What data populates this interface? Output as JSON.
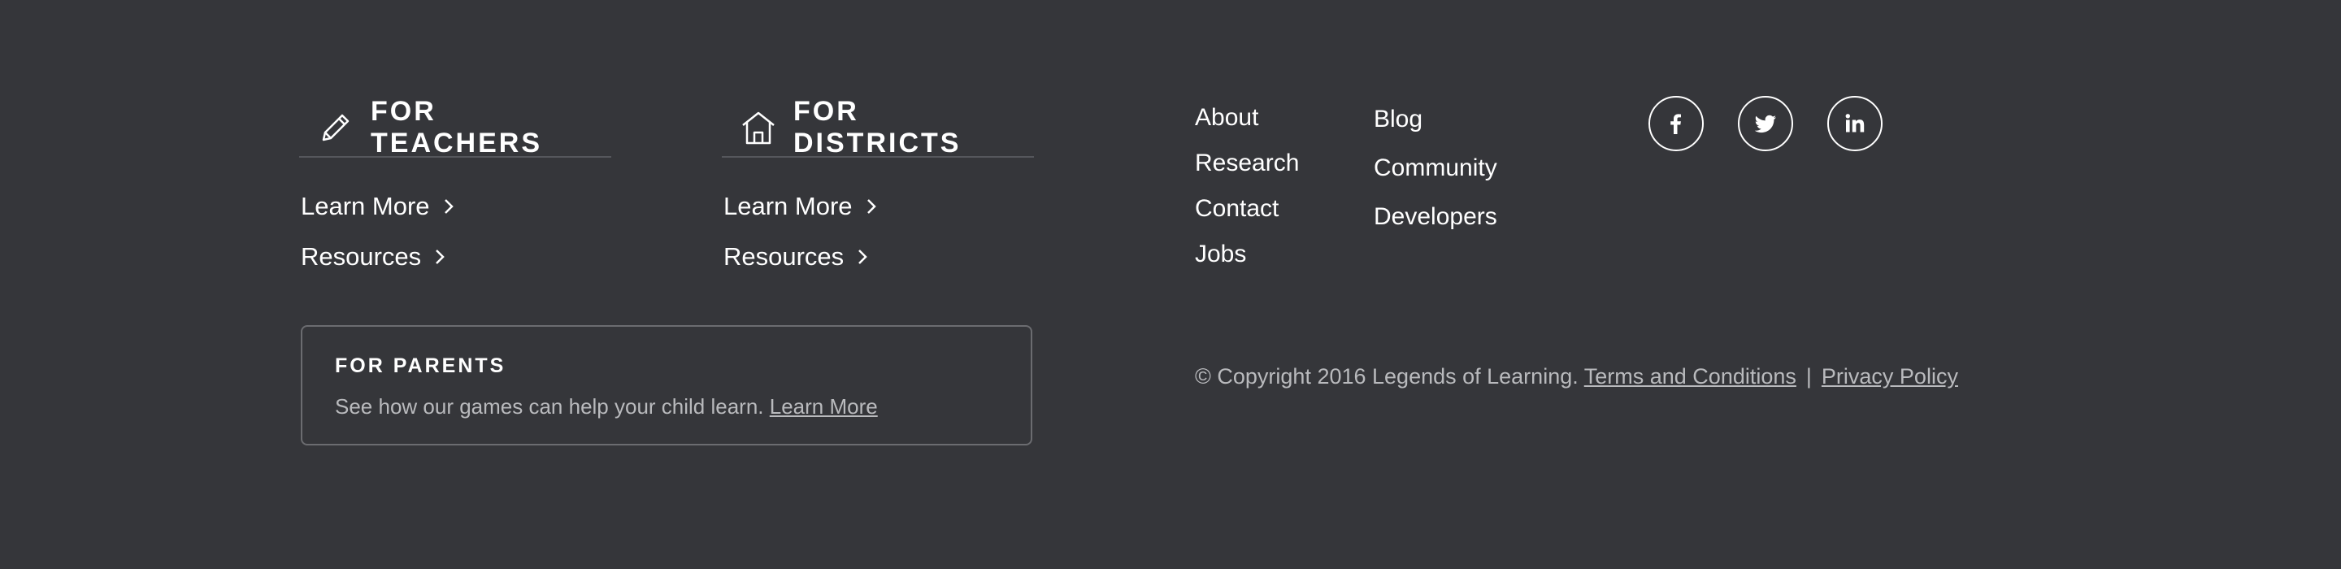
{
  "teachers": {
    "title": "FOR TEACHERS",
    "icon": "pencil-icon",
    "links": [
      "Learn More",
      "Resources"
    ]
  },
  "districts": {
    "title": "FOR DISTRICTS",
    "icon": "school-icon",
    "links": [
      "Learn More",
      "Resources"
    ]
  },
  "parents": {
    "title": "FOR PARENTS",
    "text": "See how our games can help your child learn.",
    "link": "Learn More"
  },
  "links_col1": [
    "About",
    "Research",
    "Contact",
    "Jobs"
  ],
  "links_col2": [
    "Blog",
    "Community",
    "Developers"
  ],
  "social": [
    "facebook-icon",
    "twitter-icon",
    "linkedin-icon"
  ],
  "copyright": {
    "text": "© Copyright 2016 Legends of Learning.",
    "terms": "Terms and Conditions",
    "separator": "|",
    "privacy": "Privacy Policy"
  },
  "colors": {
    "background": "#35363a",
    "text": "#ffffff",
    "muted_text": "#b9babd",
    "border": "#6b6c70"
  }
}
